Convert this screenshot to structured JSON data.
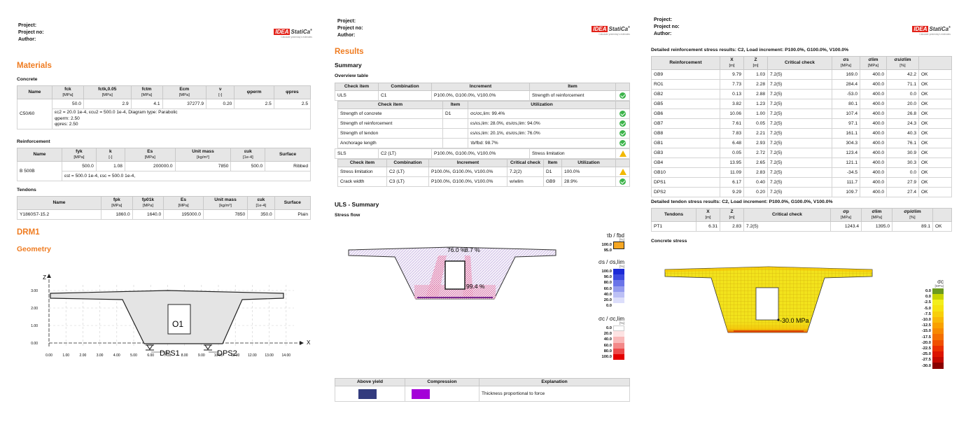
{
  "header": {
    "project": "Project:",
    "project_no": "Project no:",
    "author": "Author:"
  },
  "logo": {
    "idea": "IDEA",
    "statica": "StatiCa",
    "reg": "®",
    "tagline": "Calculate yesterday's estimates"
  },
  "p1": {
    "materials_title": "Materials",
    "concrete_title": "Concrete",
    "concrete_table": {
      "headers": [
        {
          "main": "Name",
          "unit": ""
        },
        {
          "main": "fck",
          "unit": "[MPa]"
        },
        {
          "main": "fctk,0.05",
          "unit": "[MPa]"
        },
        {
          "main": "fctm",
          "unit": "[MPa]"
        },
        {
          "main": "Ecm",
          "unit": "[MPa]"
        },
        {
          "main": "ν",
          "unit": "[-]"
        },
        {
          "main": "φperm",
          "unit": ""
        },
        {
          "main": "φpres",
          "unit": ""
        }
      ],
      "name": "C50/60",
      "values": [
        "50.0",
        "2.9",
        "4.1",
        "37277.9",
        "0.20",
        "2.5",
        "2.5"
      ],
      "note1": "εc2 = 20.0 1e-4, εcu2 = 500.0 1e-4, Diagram type: Parabolic",
      "note2": "φperm: 2.50",
      "note3": "φpres: 2.50"
    },
    "reinforcement_title": "Reinforcement",
    "reinf_table": {
      "headers": [
        {
          "main": "Name",
          "unit": ""
        },
        {
          "main": "fyk",
          "unit": "[MPa]"
        },
        {
          "main": "k",
          "unit": "[-]"
        },
        {
          "main": "Es",
          "unit": "[MPa]"
        },
        {
          "main": "Unit mass",
          "unit": "[kg/m³]"
        },
        {
          "main": "εuk",
          "unit": "[1e-4]"
        },
        {
          "main": "Surface",
          "unit": ""
        }
      ],
      "name": "B 500B",
      "values": [
        "500.0",
        "1.08",
        "200000.0",
        "7850",
        "500.0",
        "Ribbed"
      ],
      "note": "εst = 500.0 1e-4, εsc = 500.0 1e-4,"
    },
    "tendons_title": "Tendons",
    "tendon_table": {
      "headers": [
        {
          "main": "Name",
          "unit": ""
        },
        {
          "main": "fpk",
          "unit": "[MPa]"
        },
        {
          "main": "fp01k",
          "unit": "[MPa]"
        },
        {
          "main": "Es",
          "unit": "[MPa]"
        },
        {
          "main": "Unit mass",
          "unit": "[kg/m³]"
        },
        {
          "main": "εuk",
          "unit": "[1e-4]"
        },
        {
          "main": "Surface",
          "unit": ""
        }
      ],
      "row": [
        "Y1860S7-15.2",
        "1860.0",
        "1640.0",
        "195000.0",
        "7850",
        "350.0",
        "Plain"
      ]
    },
    "drm_title": "DRM1",
    "geometry_title": "Geometry",
    "geometry": {
      "axis_z": "Z",
      "axis_x": "X",
      "z_ticks": [
        "3.00",
        "2.00",
        "1.00",
        "0.00"
      ],
      "x_ticks": [
        "0.00",
        "1.00",
        "2.00",
        "3.00",
        "4.00",
        "5.00",
        "6.00",
        "7.00",
        "8.00",
        "9.00",
        "10.00",
        "11.00",
        "12.00",
        "13.00",
        "14.00"
      ],
      "o1": "O1",
      "dps1": "DPS1",
      "dps2": "DPS2"
    }
  },
  "p2": {
    "results_title": "Results",
    "summary_title": "Summary",
    "overview_title": "Overview table",
    "overview_headers": [
      "Check item",
      "Combination",
      "Increment",
      "Item"
    ],
    "uls_row": [
      "ULS",
      "C1",
      "P100.0%, G100.0%, V100.0%",
      "Strength of reinforcement"
    ],
    "uls_sub_headers": [
      "Check item",
      "Item",
      "Utilization"
    ],
    "uls_sub_rows": [
      [
        "Strength of concrete",
        "D1",
        "σc/σc,lim: 99.4%"
      ],
      [
        "Strength of reinforcement",
        "",
        "εs/εs,lim: 28.0%, σs/σs,lim: 94.0%"
      ],
      [
        "Strength of tendon",
        "",
        "εs/εs,lim: 20.1%, σs/σs,lim: 76.0%"
      ],
      [
        "Anchorage length",
        "",
        "τb/fbd: 98.7%"
      ]
    ],
    "sls_row": [
      "SLS",
      "C2 (LT)",
      "P100.0%, G100.0%, V100.0%",
      "Stress limitation"
    ],
    "sls_sub_headers": [
      "Check item",
      "Combination",
      "Increment",
      "Critical check",
      "Item",
      "Utilization"
    ],
    "sls_sub_rows": [
      [
        "Stress limitation",
        "C2 (LT)",
        "P100.0%, G100.0%, V100.0%",
        "7.2(2)",
        "D1",
        "100.0%"
      ],
      [
        "Crack width",
        "C3 (LT)",
        "P100.0%, G100.0%, V100.0%",
        "w/wlim",
        "GB9",
        "28.9%"
      ]
    ],
    "uls_summary_title": "ULS - Summary",
    "stress_flow_title": "Stress flow",
    "flow_labels": {
      "a": "76.0 %",
      "b": "8.7 %",
      "c": "99.4 %"
    },
    "legend1": {
      "title": "τb / fbd",
      "unit": "[%]",
      "values": [
        "100.0",
        "95.0"
      ]
    },
    "legend2": {
      "title": "σs / σs,lim",
      "unit": "[%]",
      "values": [
        "100.0",
        "90.0",
        "80.0",
        "60.0",
        "40.0",
        "20.0",
        "0.0"
      ]
    },
    "legend3": {
      "title": "σc / σc,lim",
      "unit": "[%]",
      "values": [
        "0.0",
        "20.0",
        "40.0",
        "60.0",
        "80.0",
        "100.0"
      ]
    },
    "bottom_headers": [
      "Above yield",
      "Compression",
      "Explanation"
    ],
    "explanation": "Thickness proportional to force",
    "colors": {
      "above_yield": "#333b7e",
      "compression": "#a400d8"
    }
  },
  "p3": {
    "reinf_title": "Detailed reinforcement stress results: C2, Load increment: P100.0%, G100.0%, V100.0%",
    "reinf_headers": [
      {
        "main": "Reinforcement",
        "unit": ""
      },
      {
        "main": "X",
        "unit": "[m]"
      },
      {
        "main": "Z",
        "unit": "[m]"
      },
      {
        "main": "Critical check",
        "unit": ""
      },
      {
        "main": "σs",
        "unit": "[MPa]"
      },
      {
        "main": "σlim",
        "unit": "[MPa]"
      },
      {
        "main": "σs/σlim",
        "unit": "[%]"
      },
      {
        "main": "",
        "unit": ""
      }
    ],
    "reinf_rows": [
      [
        "GB9",
        "9.79",
        "1.03",
        "7.2(5)",
        "169.0",
        "400.0",
        "42.2",
        "OK"
      ],
      [
        "RO1",
        "7.73",
        "2.28",
        "7.2(5)",
        "284.4",
        "400.0",
        "71.1",
        "OK"
      ],
      [
        "GB2",
        "0.13",
        "2.88",
        "7.2(5)",
        "-53.0",
        "400.0",
        "0.0",
        "OK"
      ],
      [
        "GB5",
        "3.82",
        "1.23",
        "7.2(5)",
        "80.1",
        "400.0",
        "20.0",
        "OK"
      ],
      [
        "GB6",
        "10.06",
        "1.00",
        "7.2(5)",
        "107.4",
        "400.0",
        "26.8",
        "OK"
      ],
      [
        "GB7",
        "7.61",
        "0.05",
        "7.2(5)",
        "97.1",
        "400.0",
        "24.3",
        "OK"
      ],
      [
        "GB8",
        "7.83",
        "2.21",
        "7.2(5)",
        "161.1",
        "400.0",
        "40.3",
        "OK"
      ],
      [
        "GB1",
        "6.48",
        "2.93",
        "7.2(5)",
        "304.3",
        "400.0",
        "76.1",
        "OK"
      ],
      [
        "GB3",
        "0.05",
        "2.72",
        "7.2(5)",
        "123.4",
        "400.0",
        "30.9",
        "OK"
      ],
      [
        "GB4",
        "13.95",
        "2.65",
        "7.2(5)",
        "121.1",
        "400.0",
        "30.3",
        "OK"
      ],
      [
        "GB10",
        "11.09",
        "2.83",
        "7.2(5)",
        "-34.5",
        "400.0",
        "0.0",
        "OK"
      ],
      [
        "DPS1",
        "6.17",
        "0.40",
        "7.2(5)",
        "111.7",
        "400.0",
        "27.9",
        "OK"
      ],
      [
        "DPS2",
        "9.29",
        "0.20",
        "7.2(5)",
        "109.7",
        "400.0",
        "27.4",
        "OK"
      ]
    ],
    "tendon_title": "Detailed tendon stress results: C2, Load increment: P100.0%, G100.0%, V100.0%",
    "tendon_headers": [
      {
        "main": "Tendons",
        "unit": ""
      },
      {
        "main": "X",
        "unit": "[m]"
      },
      {
        "main": "Z",
        "unit": "[m]"
      },
      {
        "main": "Critical check",
        "unit": ""
      },
      {
        "main": "σp",
        "unit": "[MPa]"
      },
      {
        "main": "σlim",
        "unit": "[MPa]"
      },
      {
        "main": "σp/σlim",
        "unit": "[%]"
      },
      {
        "main": "",
        "unit": ""
      }
    ],
    "tendon_row": [
      "PT1",
      "6.31",
      "2.83",
      "7.2(5)",
      "1243.4",
      "1395.0",
      "89.1",
      "OK"
    ],
    "concrete_stress_title": "Concrete stress",
    "stress_label": "-30.0 MPa",
    "legend": {
      "title": "σc",
      "unit": "[MPa]",
      "values": [
        "0.0",
        "0.0",
        "-2.5",
        "-5.0",
        "-7.5",
        "-10.0",
        "-12.5",
        "-15.0",
        "-17.5",
        "-20.0",
        "-22.5",
        "-25.0",
        "-27.5",
        "-30.0"
      ],
      "colors": [
        "#6c9a1f",
        "#c8d400",
        "#f3ee1b",
        "#f6e20f",
        "#f8cf0a",
        "#f9b806",
        "#f9a100",
        "#f78a00",
        "#f46f00",
        "#f05000",
        "#ea2e00",
        "#dc1400",
        "#c30800",
        "#8a0000"
      ]
    }
  }
}
